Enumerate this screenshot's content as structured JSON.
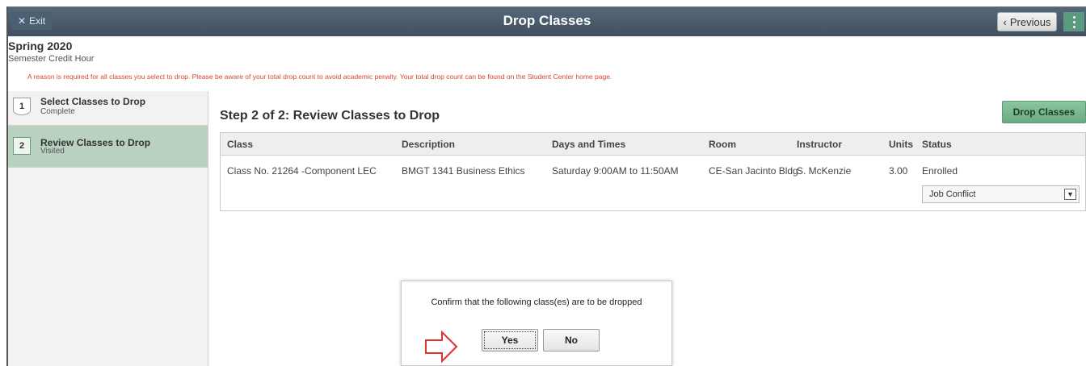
{
  "banner": {
    "exit_label": "Exit",
    "title": "Drop Classes",
    "previous_label": "Previous"
  },
  "header": {
    "term": "Spring 2020",
    "career": "Semester Credit Hour",
    "warning": "A reason is required for all classes you select to drop. Please be aware of your total drop count to avoid academic penalty. Your total drop count can be found on the Student Center home page."
  },
  "steps": [
    {
      "num": "1",
      "title": "Select Classes to Drop",
      "status": "Complete"
    },
    {
      "num": "2",
      "title": "Review Classes to Drop",
      "status": "Visited"
    }
  ],
  "main": {
    "title": "Step 2 of 2: Review Classes to Drop",
    "drop_button": "Drop Classes"
  },
  "table": {
    "headers": [
      "Class",
      "Description",
      "Days and Times",
      "Room",
      "Instructor",
      "Units",
      "Status"
    ],
    "row": {
      "class": "Class No. 21264 -Component LEC",
      "description": "BMGT 1341  Business Ethics",
      "days_times": "Saturday  9:00AM to 11:50AM",
      "room": "CE-San Jacinto Bldg",
      "instructor": "S. McKenzie",
      "units": "3.00",
      "status": "Enrolled",
      "reason": "Job Conflict"
    }
  },
  "dialog": {
    "message": "Confirm that the following class(es) are to be dropped",
    "yes_label": "Yes",
    "no_label": "No"
  },
  "colors": {
    "banner": "#46576a",
    "accent_green": "#6aaa82",
    "active_step": "#b9d2c0",
    "warning_red": "#d4453a"
  }
}
